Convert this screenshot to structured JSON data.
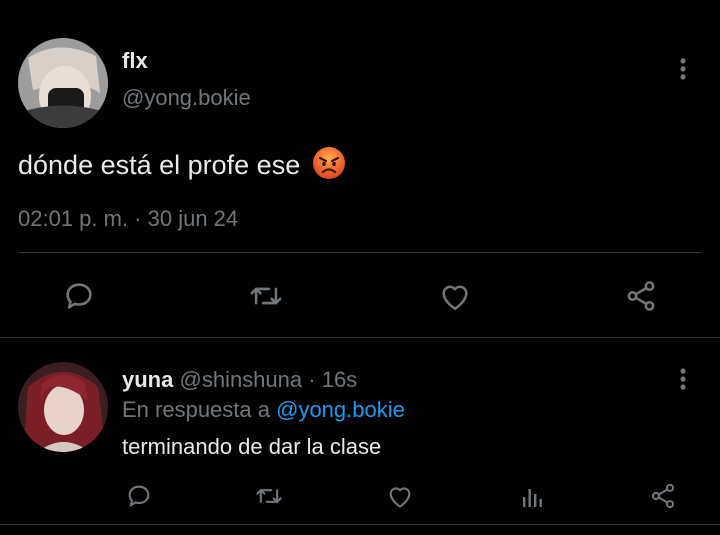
{
  "tweet": {
    "author_name": "flx",
    "author_handle": "@yong.bokie",
    "text": "dónde está el profe ese",
    "emoji": "😡",
    "timestamp": "02:01 p. m. · 30 jun 24",
    "actions": {
      "reply_icon": "reply-icon",
      "retweet_icon": "retweet-icon",
      "like_icon": "heart-icon",
      "share_icon": "share-icon"
    }
  },
  "reply": {
    "author_name": "yuna",
    "author_handle": "@shinshuna",
    "separator": "·",
    "time_ago": "16s",
    "in_reply_prefix": "En respuesta a",
    "in_reply_handle": "@yong.bokie",
    "text": "terminando de dar la clase",
    "actions": {
      "reply_icon": "reply-icon",
      "retweet_icon": "retweet-icon",
      "like_icon": "heart-icon",
      "views_icon": "views-icon",
      "share_icon": "share-icon"
    }
  },
  "colors": {
    "background": "#000000",
    "text": "#e7e9ea",
    "muted": "#71767b",
    "link": "#1d9bf0",
    "divider": "#2f3336"
  }
}
